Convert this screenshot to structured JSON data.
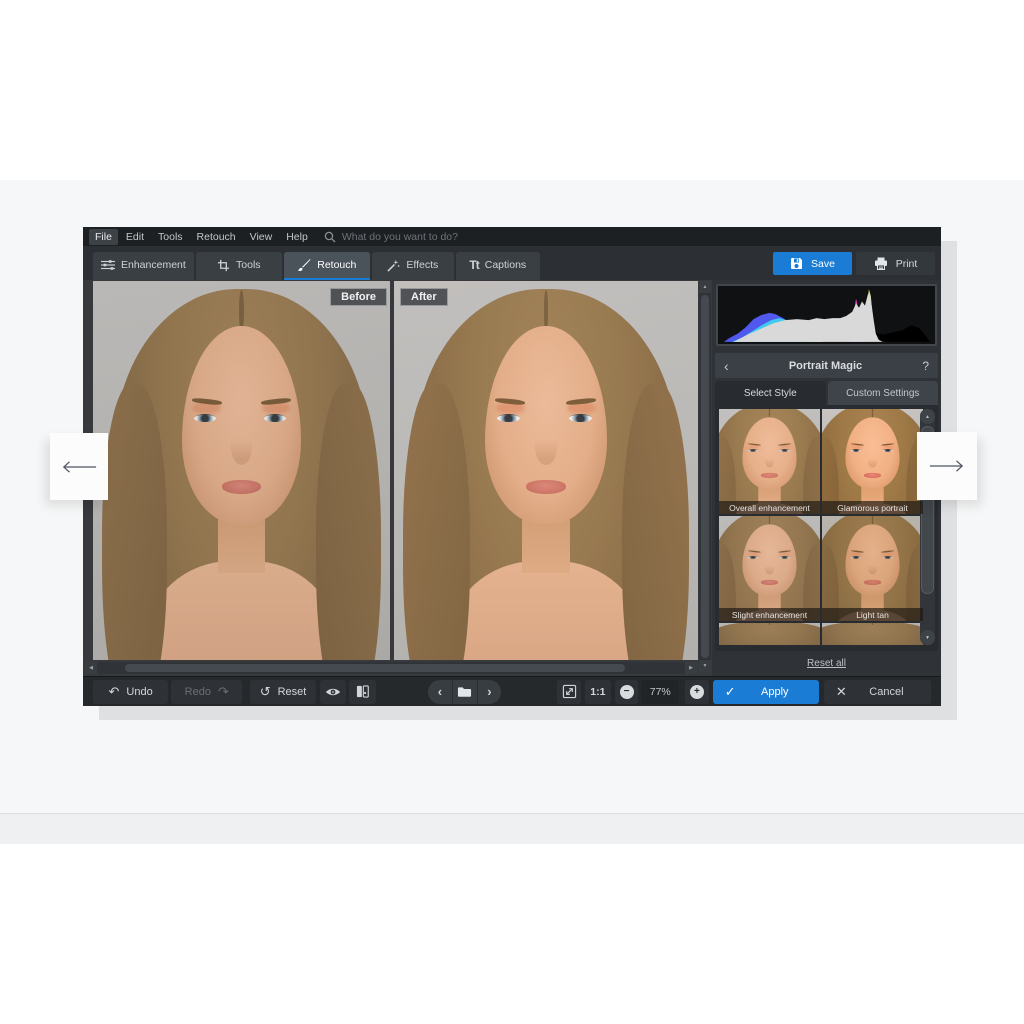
{
  "colors": {
    "accent_blue": "#1a7cd4",
    "window_bg": "#2b2e32",
    "menubar_bg": "#1d2023",
    "panel_bg": "#2f3337",
    "histogram_bg": "#0f1113"
  },
  "menu": {
    "items": [
      "File",
      "Edit",
      "Tools",
      "Retouch",
      "View",
      "Help"
    ],
    "active_item": "File",
    "search_placeholder": "What do you want to do?"
  },
  "toolbar": {
    "tabs": [
      "Enhancement",
      "Tools",
      "Retouch",
      "Effects",
      "Captions"
    ],
    "active_tab": "Retouch",
    "save_label": "Save",
    "print_label": "Print"
  },
  "canvas": {
    "before_label": "Before",
    "after_label": "After"
  },
  "panel": {
    "title": "Portrait Magic",
    "tabs": [
      "Select Style",
      "Custom Settings"
    ],
    "active_tab": "Select Style",
    "styles": [
      "Overall enhancement",
      "Glamorous portrait",
      "Slight enhancement",
      "Light tan"
    ],
    "reset_all_label": "Reset all"
  },
  "bottom_bar": {
    "undo": "Undo",
    "redo": "Redo",
    "reset": "Reset",
    "zoom_actual": "1:1",
    "zoom_level": "77%",
    "apply": "Apply",
    "cancel": "Cancel"
  },
  "icons": {
    "captions_glyph": "Tt",
    "help_glyph": "?",
    "back_glyph": "‹",
    "prev_glyph": "‹",
    "next_glyph": "›",
    "undo_glyph": "↶",
    "redo_glyph": "↷",
    "reset_glyph": "↺",
    "minus_glyph": "−",
    "plus_glyph": "+",
    "check_glyph": "✓",
    "cross_glyph": "✕",
    "up_glyph": "▲",
    "down_glyph": "▼",
    "left_glyph": "◀",
    "right_glyph": "▶"
  }
}
